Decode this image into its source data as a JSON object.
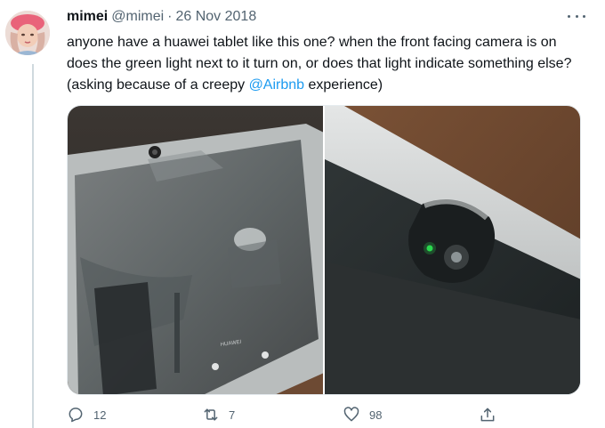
{
  "tweet": {
    "author": {
      "display_name": "mimei",
      "handle": "@mimei",
      "separator": "·",
      "date": "26 Nov 2018"
    },
    "text_before": "anyone have a huawei tablet like this one? when the front facing camera is on does the green light next to it turn on, or does that light indicate something else? (asking because of a creepy ",
    "mention": "@Airbnb",
    "text_after": " experience)",
    "media": [
      {
        "icon": "tablet-photo",
        "brand_text": "HUAWEI"
      },
      {
        "icon": "camera-closeup-photo"
      }
    ],
    "actions": {
      "reply_count": "12",
      "retweet_count": "7",
      "like_count": "98"
    }
  },
  "colors": {
    "accent": "#1d9bf0",
    "secondary_text": "#536471",
    "camera_led": "#2bd84e"
  }
}
